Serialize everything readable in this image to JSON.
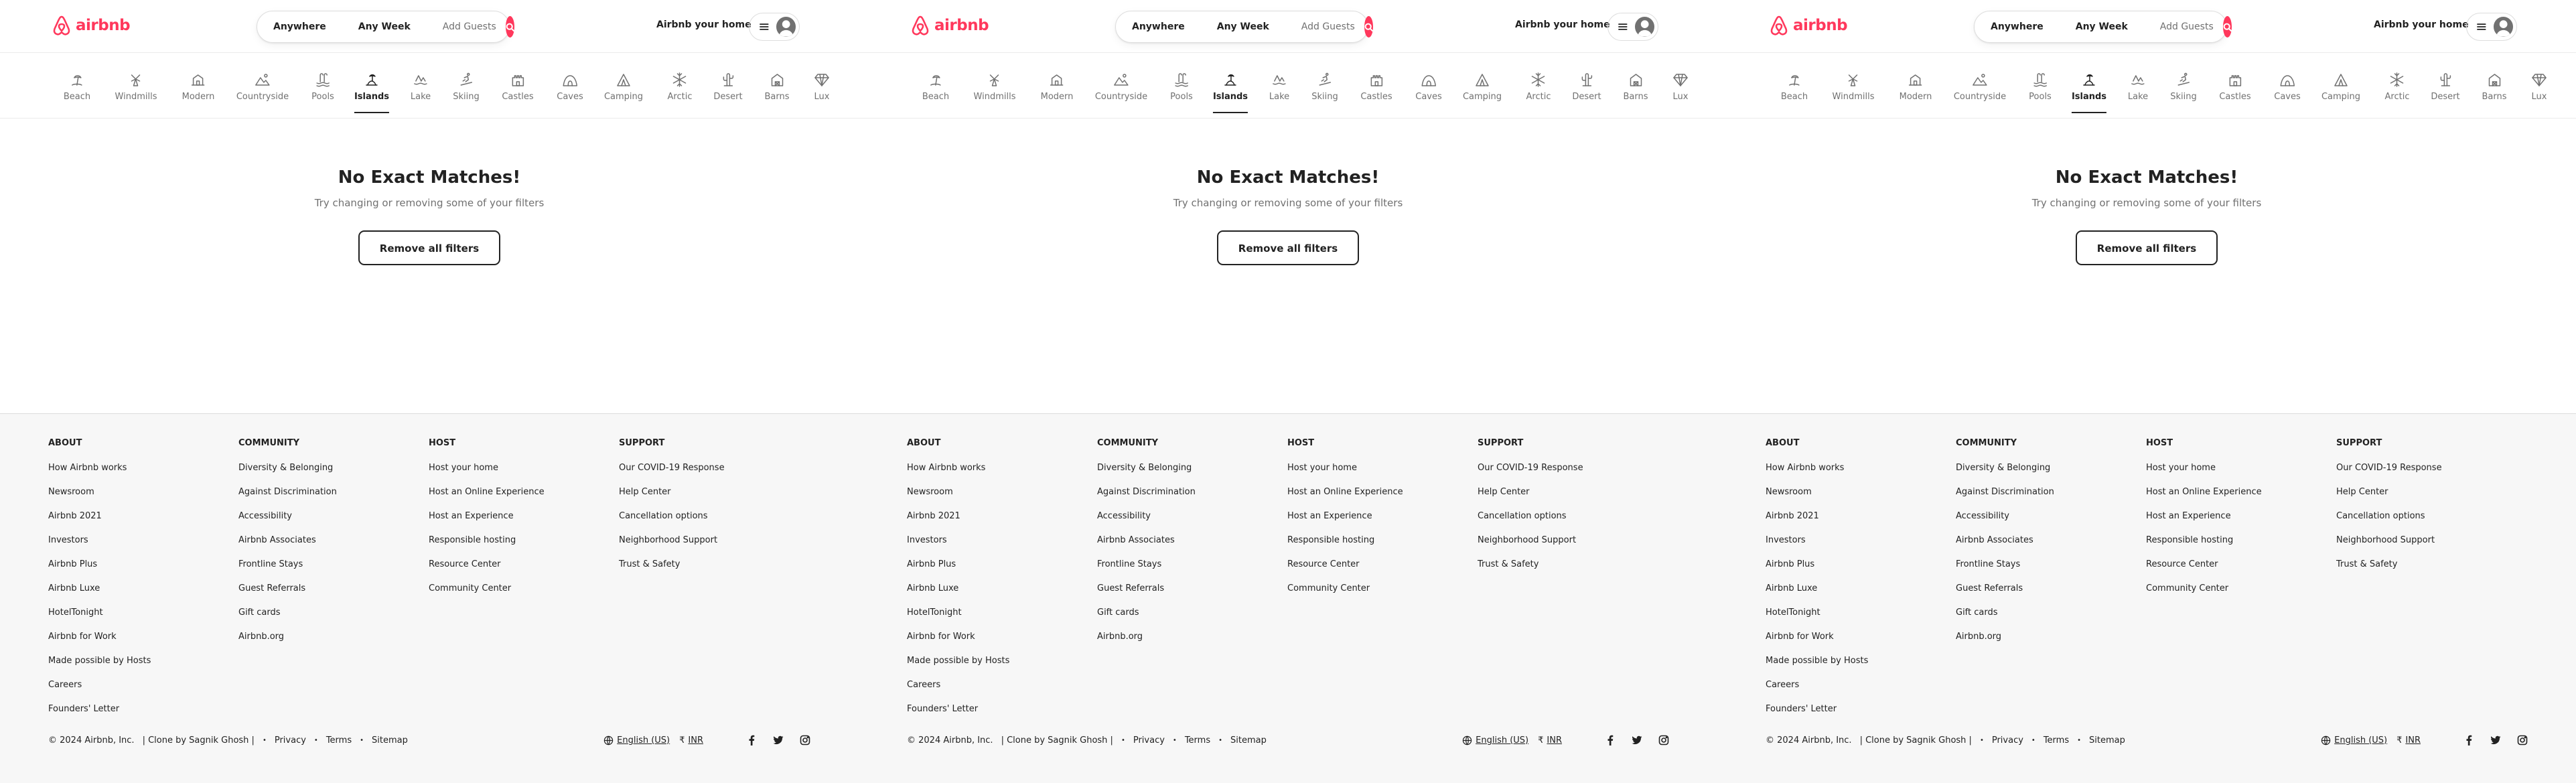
{
  "brand": {
    "name": "airbnb",
    "color": "#ff385c"
  },
  "search": {
    "anywhere": "Anywhere",
    "any_week": "Any Week",
    "add_guests": "Add Guests",
    "icon": "search-icon"
  },
  "header": {
    "host_link": "Airbnb your home",
    "menu_icon": "hamburger-menu-icon",
    "avatar_icon": "user-avatar-icon"
  },
  "categories": [
    {
      "label": "Beach",
      "icon": "beach-icon"
    },
    {
      "label": "Windmills",
      "icon": "windmill-icon"
    },
    {
      "label": "Modern",
      "icon": "modern-house-icon"
    },
    {
      "label": "Countryside",
      "icon": "countryside-icon"
    },
    {
      "label": "Pools",
      "icon": "pool-icon"
    },
    {
      "label": "Islands",
      "icon": "island-icon",
      "active": true
    },
    {
      "label": "Lake",
      "icon": "lake-icon"
    },
    {
      "label": "Skiing",
      "icon": "skiing-icon"
    },
    {
      "label": "Castles",
      "icon": "castle-icon"
    },
    {
      "label": "Caves",
      "icon": "cave-icon"
    },
    {
      "label": "Camping",
      "icon": "camping-icon"
    },
    {
      "label": "Arctic",
      "icon": "snowflake-icon"
    },
    {
      "label": "Desert",
      "icon": "cactus-icon"
    },
    {
      "label": "Barns",
      "icon": "barn-icon"
    },
    {
      "label": "Lux",
      "icon": "diamond-icon"
    }
  ],
  "empty_state": {
    "title": "No Exact Matches!",
    "subtitle": "Try changing or removing some of your filters",
    "button": "Remove all filters"
  },
  "footer": {
    "columns": [
      {
        "title": "ABOUT",
        "links": [
          "How Airbnb works",
          "Newsroom",
          "Airbnb 2021",
          "Investors",
          "Airbnb Plus",
          "Airbnb Luxe",
          "HotelTonight",
          "Airbnb for Work",
          "Made possible by Hosts",
          "Careers",
          "Founders' Letter"
        ]
      },
      {
        "title": "COMMUNITY",
        "links": [
          "Diversity & Belonging",
          "Against Discrimination",
          "Accessibility",
          "Airbnb Associates",
          "Frontline Stays",
          "Guest Referrals",
          "Gift cards",
          "Airbnb.org"
        ]
      },
      {
        "title": "HOST",
        "links": [
          "Host your home",
          "Host an Online Experience",
          "Host an Experience",
          "Responsible hosting",
          "Resource Center",
          "Community Center"
        ]
      },
      {
        "title": "SUPPORT",
        "links": [
          "Our COVID-19 Response",
          "Help Center",
          "Cancellation options",
          "Neighborhood Support",
          "Trust & Safety"
        ]
      }
    ],
    "copyright": "© 2024 Airbnb, Inc.",
    "clone_credit": "| Clone by Sagnik Ghosh |",
    "privacy": "Privacy",
    "terms": "Terms",
    "sitemap": "Sitemap",
    "language": "English (US)",
    "currency": "INR",
    "social": [
      "facebook-icon",
      "twitter-icon",
      "instagram-icon"
    ]
  }
}
